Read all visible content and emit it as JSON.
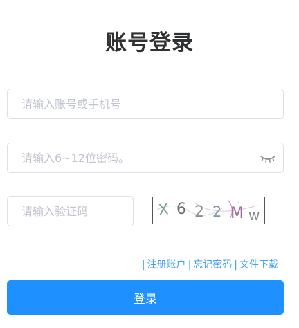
{
  "page": {
    "title": "账号登录"
  },
  "form": {
    "account_placeholder": "请输入账号或手机号",
    "password_placeholder": "请输入6~12位密码。",
    "captcha_placeholder": "请输入验证码",
    "captcha_text": [
      "X",
      "6",
      "2",
      "2",
      "M",
      "w"
    ],
    "captcha_colors": [
      "#7a9a86",
      "#6d6d6d",
      "#8c8c8c",
      "#7f96a6",
      "#a06a9c",
      "#8a8a8a"
    ]
  },
  "links": {
    "separator": "|",
    "register": "注册账户",
    "forgot": "忘记密码",
    "download": "文件下载"
  },
  "actions": {
    "login_label": "登录"
  },
  "colors": {
    "accent": "#1e90ff",
    "link": "#409eff",
    "border": "#dcdfe6",
    "placeholder": "#c0c4cc"
  },
  "icons": {
    "password_toggle": "eye-closed-icon"
  }
}
